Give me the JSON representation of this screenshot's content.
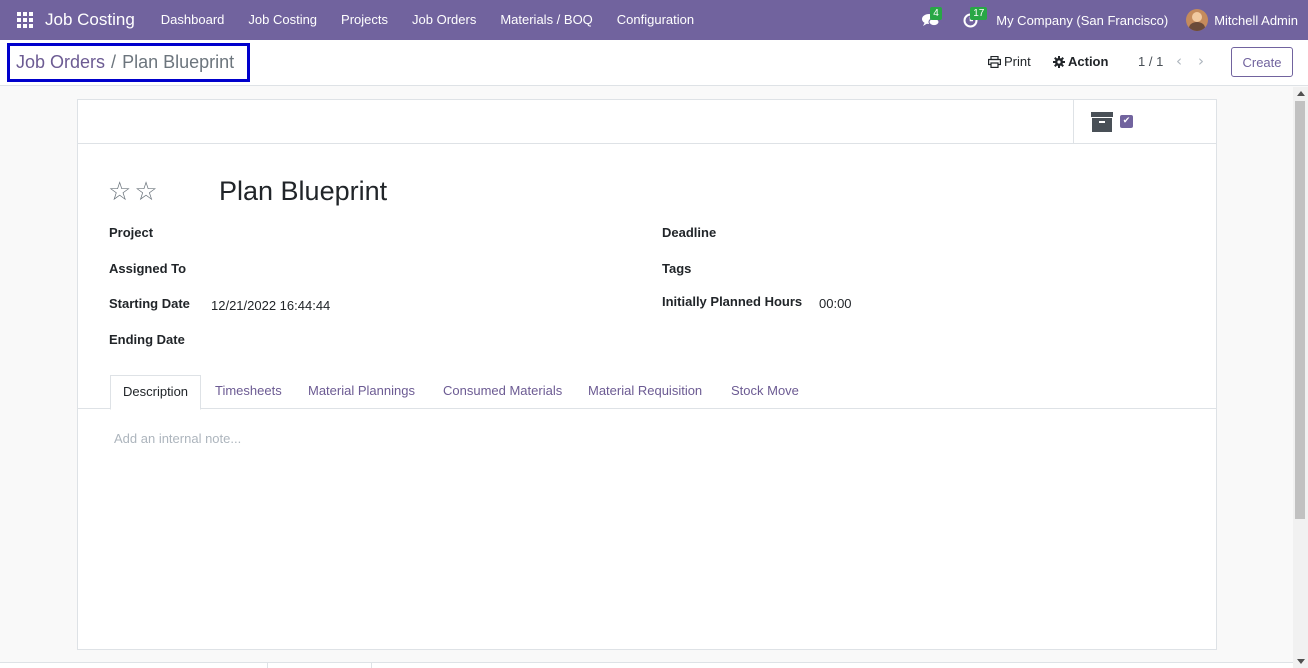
{
  "navbar": {
    "brand": "Job Costing",
    "menu": [
      "Dashboard",
      "Job Costing",
      "Projects",
      "Job Orders",
      "Materials / BOQ",
      "Configuration"
    ],
    "messages_count": "4",
    "activities_count": "17",
    "company": "My Company (San Francisco)",
    "user": "Mitchell Admin",
    "color": "#71639e"
  },
  "breadcrumb": {
    "parent": "Job Orders",
    "separator": "/",
    "current": "Plan Blueprint"
  },
  "control": {
    "print_label": "Print",
    "action_label": "Action",
    "pager": "1 / 1",
    "create_label": "Create"
  },
  "form": {
    "title": "Plan Blueprint",
    "fields_left": [
      {
        "label": "Project",
        "value": ""
      },
      {
        "label": "Assigned To",
        "value": ""
      },
      {
        "label": "Starting Date",
        "value": "12/21/2022 16:44:44"
      },
      {
        "label": "Ending Date",
        "value": ""
      }
    ],
    "fields_right": [
      {
        "label": "Deadline",
        "value": ""
      },
      {
        "label": "Tags",
        "value": ""
      },
      {
        "label": "Initially Planned Hours",
        "value": "00:00"
      }
    ],
    "tabs": [
      "Description",
      "Timesheets",
      "Material Plannings",
      "Consumed Materials",
      "Material Requisition",
      "Stock Move"
    ],
    "active_tab": "Description",
    "note_placeholder": "Add an internal note..."
  },
  "icons": {
    "apps": "apps-grid-icon",
    "messages": "chat-icon",
    "activities": "clock-icon",
    "print": "printer-icon",
    "action": "gear-icon",
    "archive": "archive-icon",
    "active": "checkbox-icon",
    "priority": "star-icon"
  }
}
